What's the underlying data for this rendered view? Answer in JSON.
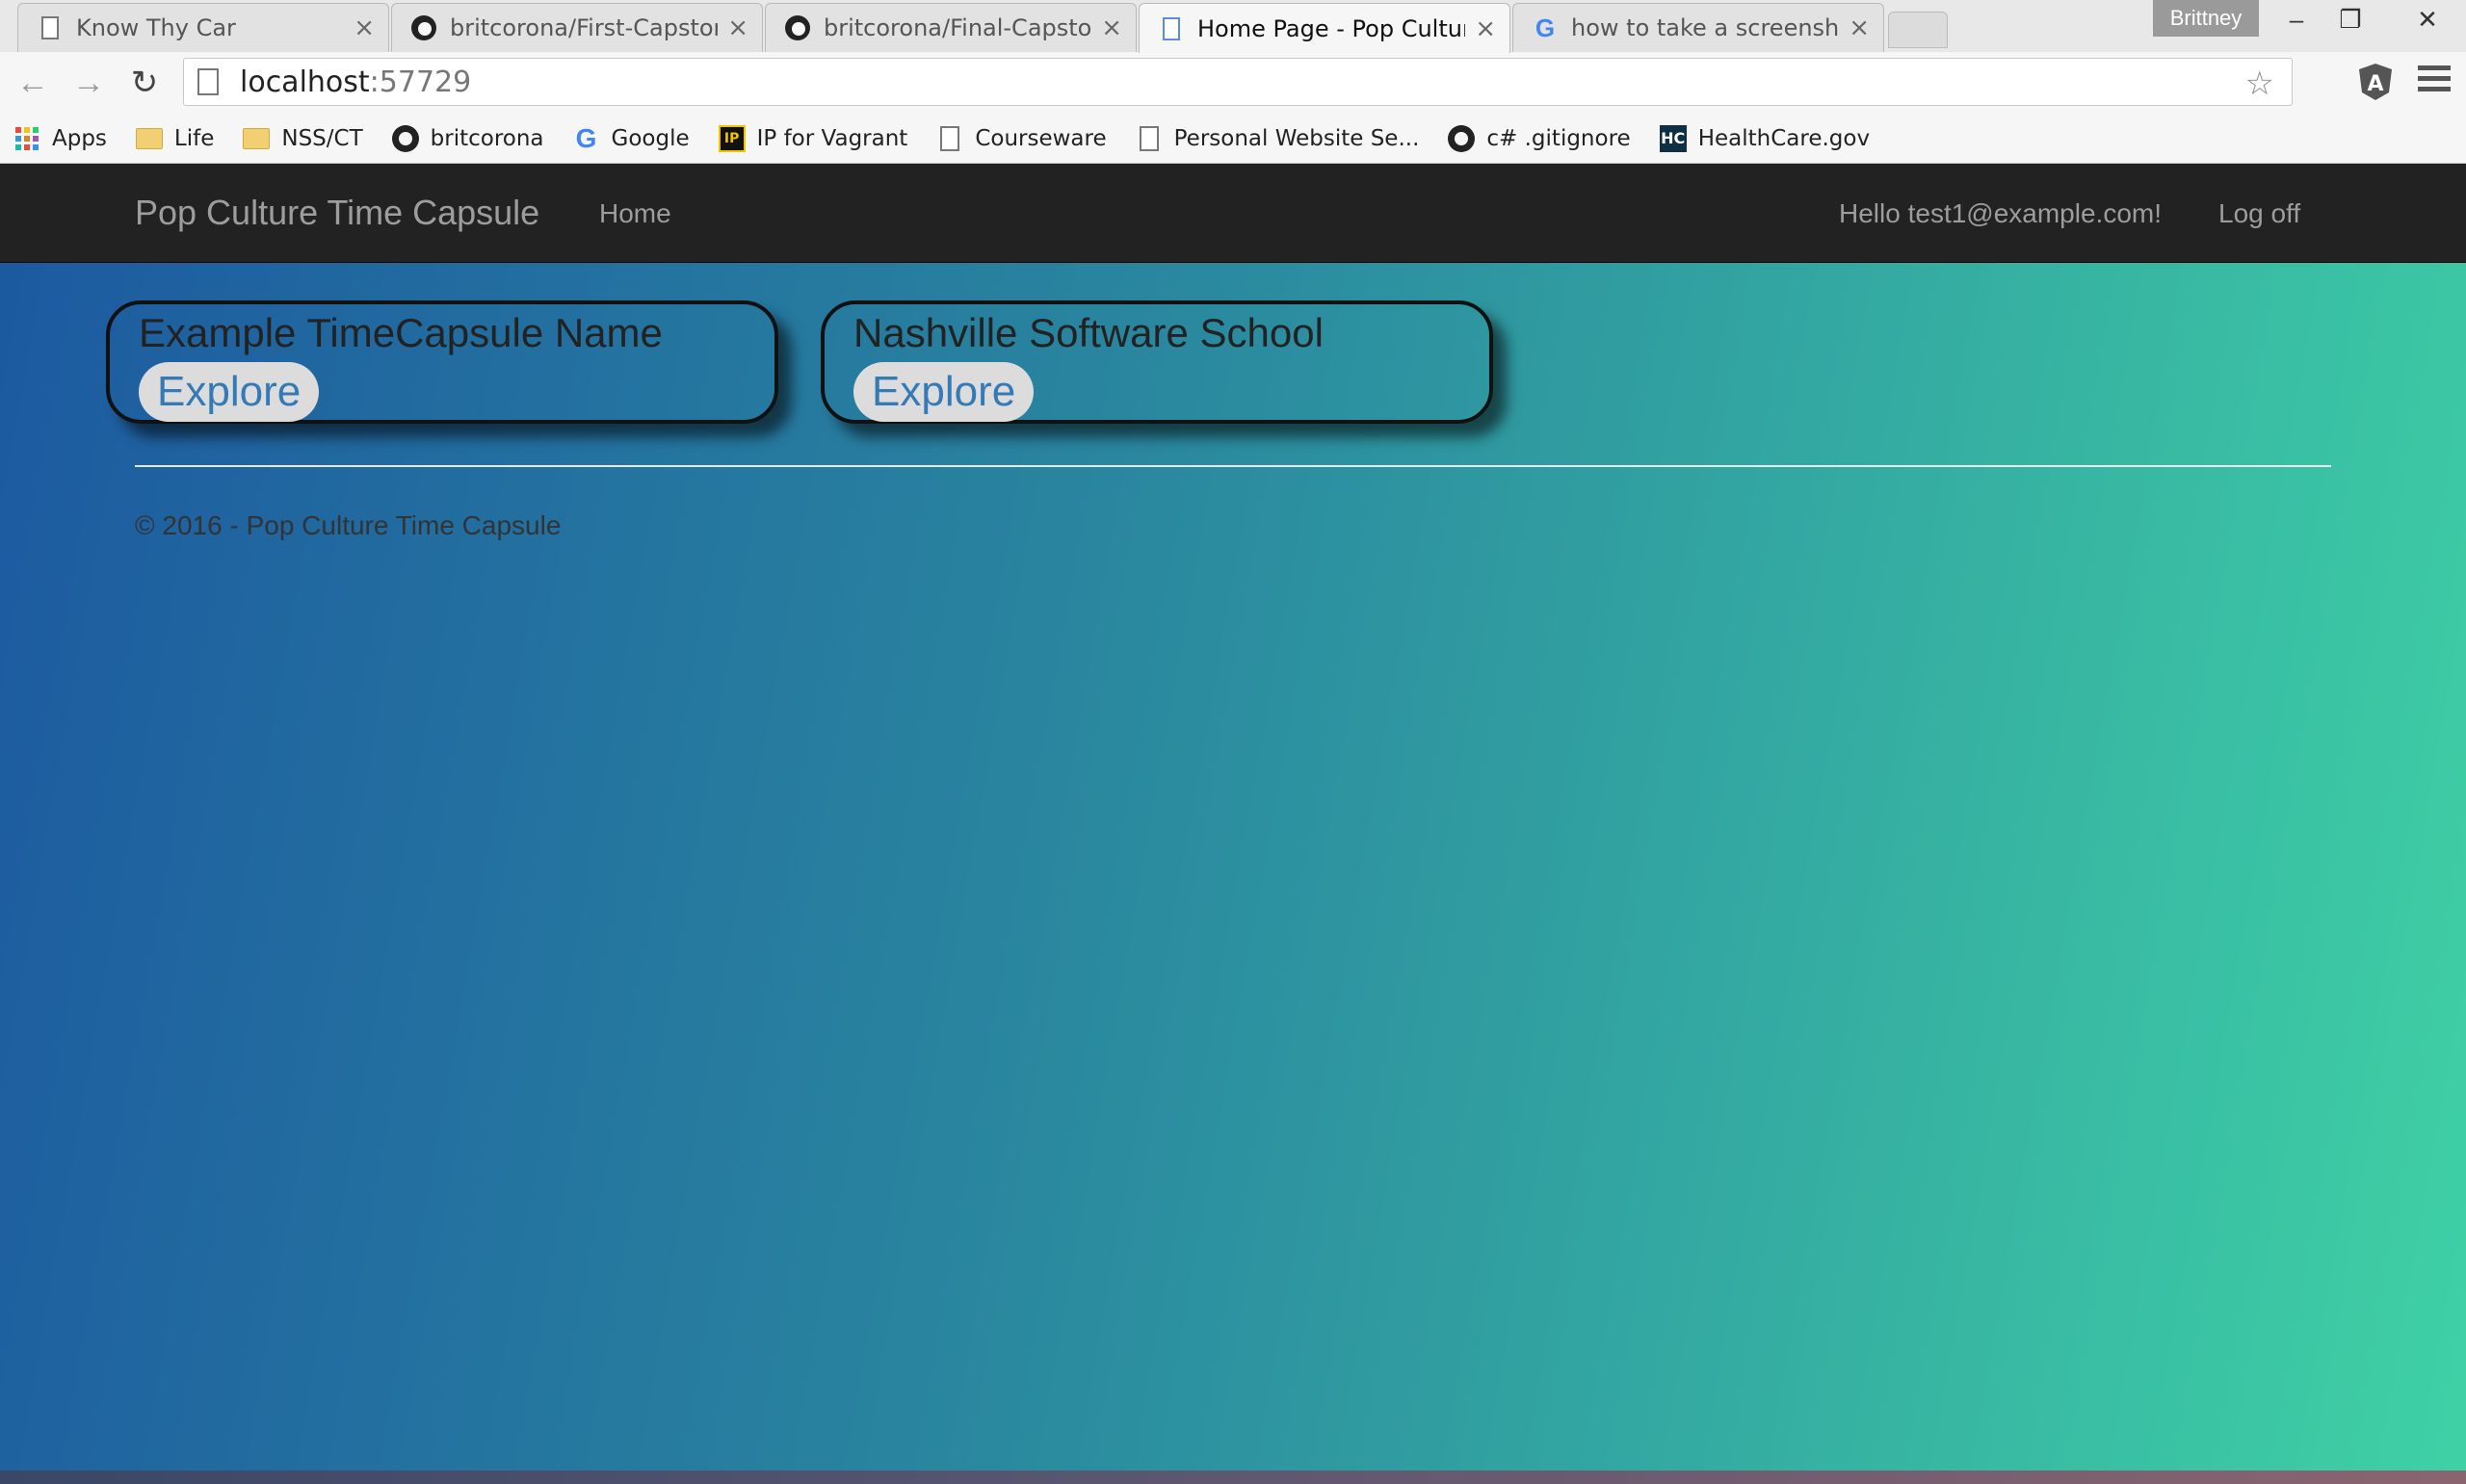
{
  "browser": {
    "tabs": [
      {
        "title": "Know Thy Car",
        "icon": "page-icon"
      },
      {
        "title": "britcorona/First-Capstone",
        "icon": "github-icon"
      },
      {
        "title": "britcorona/Final-Capstone",
        "icon": "github-icon"
      },
      {
        "title": "Home Page - Pop Culture",
        "icon": "page-icon",
        "active": true
      },
      {
        "title": "how to take a screenshot",
        "icon": "google-icon"
      }
    ],
    "profile": "Brittney",
    "address": {
      "host": "localhost",
      "port": ":57729"
    },
    "bookmarks": [
      {
        "label": "Apps",
        "icon": "apps-grid-icon"
      },
      {
        "label": "Life",
        "icon": "folder-icon"
      },
      {
        "label": "NSS/CT",
        "icon": "folder-icon"
      },
      {
        "label": "britcorona",
        "icon": "github-icon"
      },
      {
        "label": "Google",
        "icon": "google-icon"
      },
      {
        "label": "IP for Vagrant",
        "icon": "ip-icon"
      },
      {
        "label": "Courseware",
        "icon": "page-icon"
      },
      {
        "label": "Personal Website Se...",
        "icon": "page-icon"
      },
      {
        "label": "c# .gitignore",
        "icon": "github-icon"
      },
      {
        "label": "HealthCare.gov",
        "icon": "healthcare-icon"
      }
    ]
  },
  "site": {
    "brand": "Pop Culture Time Capsule",
    "nav": {
      "home": "Home",
      "greeting": "Hello test1@example.com!",
      "logoff": "Log off"
    },
    "capsules": [
      {
        "name": "Example TimeCapsule Name",
        "button": "Explore"
      },
      {
        "name": "Nashville Software School",
        "button": "Explore"
      }
    ],
    "footer": "© 2016 - Pop Culture Time Capsule"
  },
  "colors": {
    "gradient_start": "#1c59a0",
    "gradient_end": "#3fd1a5",
    "navbar": "#222222",
    "link": "#337ab7"
  }
}
